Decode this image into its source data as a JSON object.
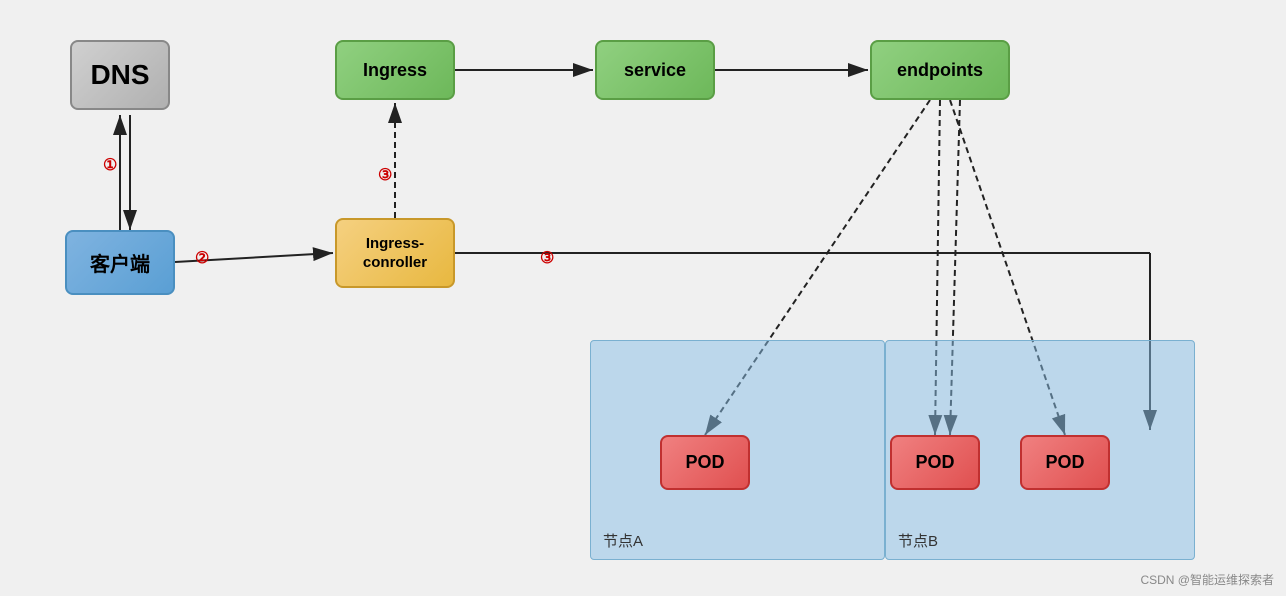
{
  "nodes": {
    "dns": {
      "label": "DNS"
    },
    "client": {
      "label": "客户端"
    },
    "ingress": {
      "label": "Ingress"
    },
    "service": {
      "label": "service"
    },
    "endpoints": {
      "label": "endpoints"
    },
    "ingress_controller": {
      "label1": "Ingress-",
      "label2": "conroller"
    },
    "pod1": {
      "label": "POD"
    },
    "pod2": {
      "label": "POD"
    },
    "pod3": {
      "label": "POD"
    }
  },
  "areas": {
    "node_a": {
      "label": "节点A"
    },
    "node_b": {
      "label": "节点B"
    }
  },
  "labels": {
    "num1": "①",
    "num2": "②",
    "num3a": "③",
    "num3b": "③"
  },
  "watermark": "CSDN @智能运维探索者"
}
